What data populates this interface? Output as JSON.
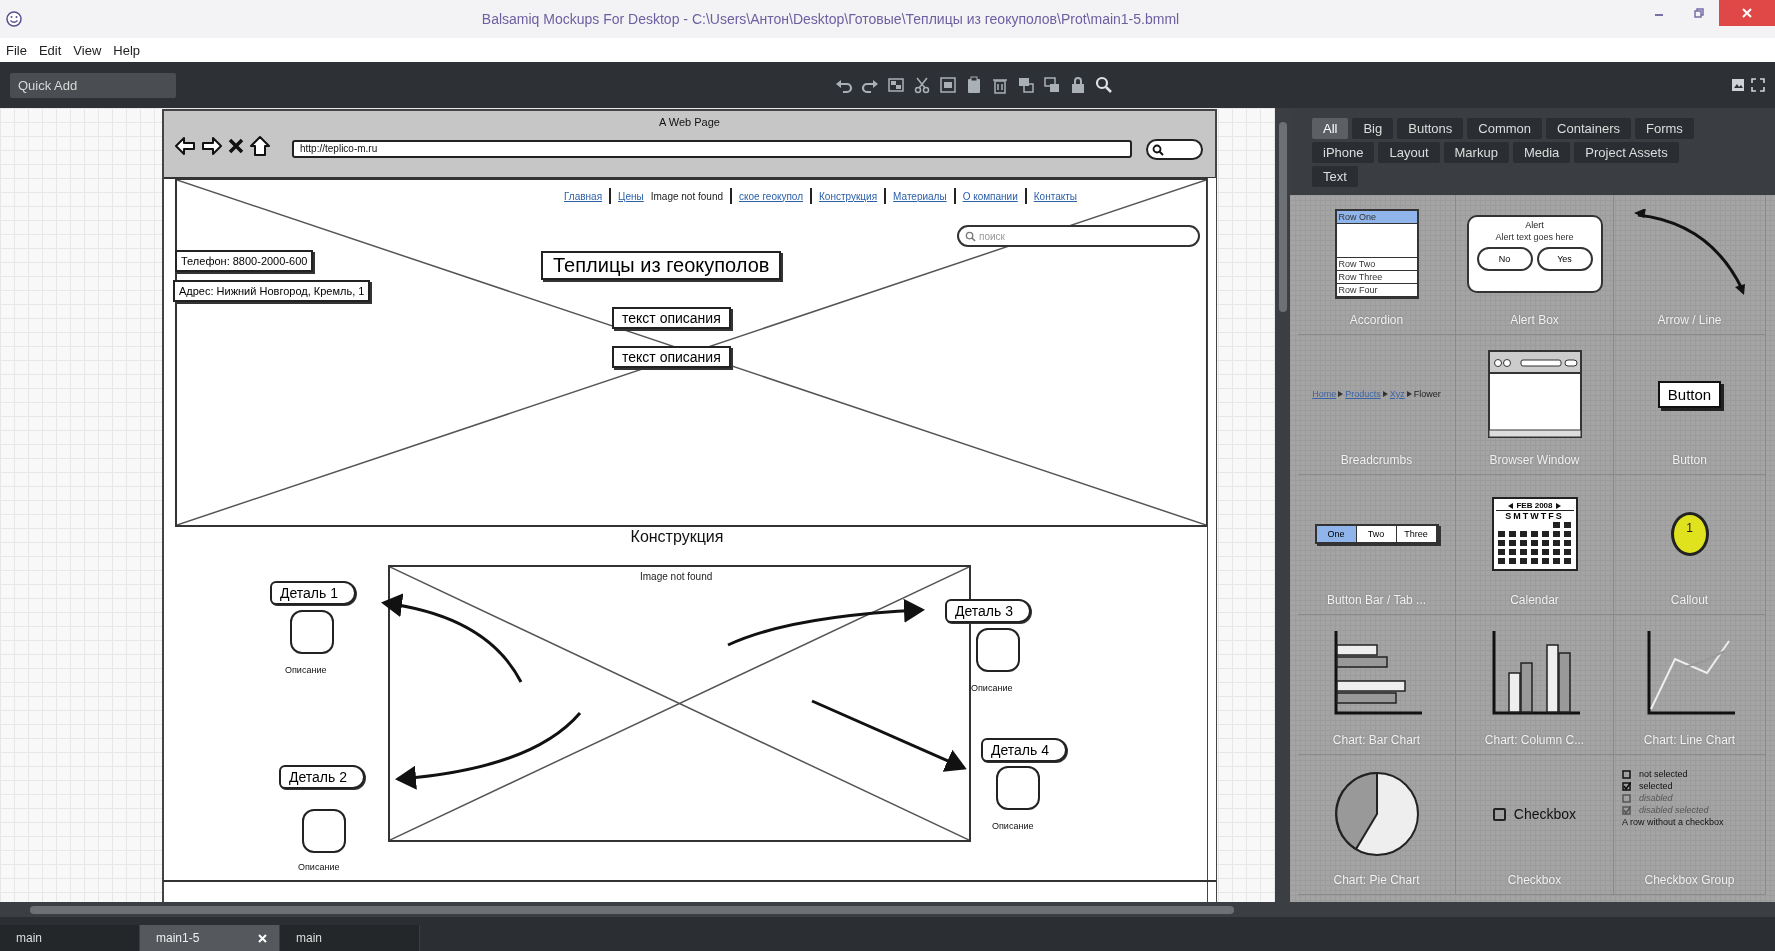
{
  "window": {
    "title": "Balsamiq Mockups For Desktop - C:\\Users\\Антон\\Desktop\\Готовые\\Теплицы из геокуполов\\Prot\\main1-5.bmml"
  },
  "menu": [
    "File",
    "Edit",
    "View",
    "Help"
  ],
  "toolbar": {
    "quick_add": {
      "placeholder": "Quick Add"
    }
  },
  "mockup": {
    "browser_title": "A Web Page",
    "url": "http://teplico-m.ru",
    "nav_links": [
      "Главная",
      "Цены",
      "ское геокупол",
      "Конструкция",
      "Материалы",
      "О компании",
      "Контакты"
    ],
    "hero": {
      "caption": "Image not found",
      "search": {
        "placeholder": "поиск"
      },
      "contacts": [
        "Телефон: 8800-2000-600",
        "Адрес: Нижний Новгород, Кремль, 1"
      ],
      "title": "Теплицы из геокуполов",
      "buttons": [
        "текст описания",
        "текст описания"
      ]
    },
    "section": {
      "heading": "Конструкция",
      "caption": "Image not found",
      "details": [
        {
          "label": "Деталь 1",
          "description": "Описание"
        },
        {
          "label": "Деталь 2",
          "description": "Описание"
        },
        {
          "label": "Деталь 3",
          "description": "Описание"
        },
        {
          "label": "Деталь 4",
          "description": "Описание"
        }
      ]
    }
  },
  "palette": {
    "filters": [
      {
        "label": "All",
        "selected": true
      },
      {
        "label": "Big",
        "selected": false
      },
      {
        "label": "Buttons",
        "selected": false
      },
      {
        "label": "Common",
        "selected": false
      },
      {
        "label": "Containers",
        "selected": false
      },
      {
        "label": "Forms",
        "selected": false
      },
      {
        "label": "iPhone",
        "selected": false
      },
      {
        "label": "Layout",
        "selected": false
      },
      {
        "label": "Markup",
        "selected": false
      },
      {
        "label": "Media",
        "selected": false
      },
      {
        "label": "Project Assets",
        "selected": false
      },
      {
        "label": "Text",
        "selected": false
      }
    ],
    "items": [
      {
        "kind": "accordion",
        "label": "Accordion",
        "rows": [
          {
            "text": "Row One",
            "selected": true
          },
          {
            "text": "Row Two",
            "selected": false
          },
          {
            "text": "Row Three",
            "selected": false
          },
          {
            "text": "Row Four",
            "selected": false
          }
        ]
      },
      {
        "kind": "alert",
        "label": "Alert Box",
        "title": "Alert",
        "text": "Alert text goes here",
        "buttons": [
          "No",
          "Yes"
        ]
      },
      {
        "kind": "arrow",
        "label": "Arrow / Line"
      },
      {
        "kind": "breadcrumbs",
        "label": "Breadcrumbs",
        "crumbs": [
          "Home",
          "Products",
          "Xyz",
          "Flower"
        ]
      },
      {
        "kind": "browser",
        "label": "Browser Window"
      },
      {
        "kind": "button",
        "label": "Button",
        "text": "Button"
      },
      {
        "kind": "buttonbar",
        "label": "Button Bar / Tab ...",
        "segments": [
          {
            "text": "One",
            "selected": true
          },
          {
            "text": "Two",
            "selected": false
          },
          {
            "text": "Three",
            "selected": false
          }
        ]
      },
      {
        "kind": "calendar",
        "label": "Calendar",
        "month": "FEB 2008",
        "weekdays": "SMTWTFS"
      },
      {
        "kind": "callout",
        "label": "Callout",
        "text": "1"
      },
      {
        "kind": "barchart",
        "label": "Chart: Bar Chart"
      },
      {
        "kind": "columnchart",
        "label": "Chart: Column C..."
      },
      {
        "kind": "linechart",
        "label": "Chart: Line Chart"
      },
      {
        "kind": "piechart",
        "label": "Chart: Pie Chart"
      },
      {
        "kind": "checkbox",
        "label": "Checkbox",
        "text": "Checkbox"
      },
      {
        "kind": "checkboxgroup",
        "label": "Checkbox Group",
        "rows": [
          {
            "text": "not selected",
            "checked": false,
            "disabled": false
          },
          {
            "text": "selected",
            "checked": true,
            "disabled": false
          },
          {
            "text": "disabled",
            "checked": false,
            "disabled": true
          },
          {
            "text": "disabled selected",
            "checked": true,
            "disabled": true
          }
        ],
        "note": "A row without a checkbox"
      }
    ]
  },
  "tabs": [
    {
      "label": "main",
      "selected": false
    },
    {
      "label": "main1-5",
      "selected": true
    },
    {
      "label": "main",
      "selected": false
    }
  ]
}
